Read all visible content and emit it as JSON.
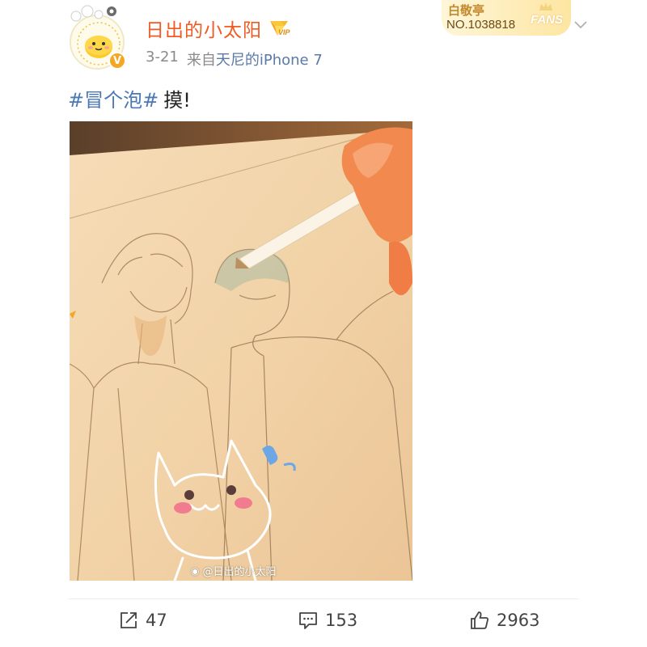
{
  "header": {
    "username": "日出的小太阳",
    "vip_label": "VIP",
    "verified_mark": "V",
    "date": "3-21",
    "source_prefix": "来自",
    "source_name": "天尼的iPhone 7",
    "fans_badge": {
      "title": "白敬亭",
      "number": "NO.1038818",
      "tag": "FANS"
    }
  },
  "post": {
    "hashtag": "#冒个泡#",
    "text": "摸!",
    "image_watermark": "@日出的小太阳"
  },
  "actions": {
    "repost_count": "47",
    "comment_count": "153",
    "like_count": "2963"
  },
  "colors": {
    "username": "#f15a22",
    "hashtag": "#4a78b6",
    "verified": "#f5a623",
    "meta": "#8a8a8a"
  },
  "icons": {
    "repost": "repost-icon",
    "comment": "comment-icon",
    "like": "like-icon",
    "more": "chevron-down-icon"
  }
}
